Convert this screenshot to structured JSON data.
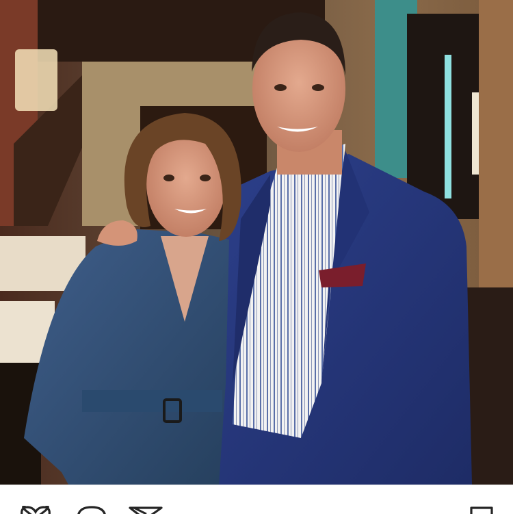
{
  "post": {
    "photo": {
      "subject": "photo"
    }
  },
  "actions": {
    "like": {
      "icon": "heart-outline-icon"
    },
    "comment": {
      "icon": "speech-bubble-icon"
    },
    "share": {
      "icon": "paper-plane-icon"
    },
    "save": {
      "icon": "bookmark-icon"
    }
  },
  "colors": {
    "icon_stroke": "#262626",
    "background": "#ffffff"
  }
}
